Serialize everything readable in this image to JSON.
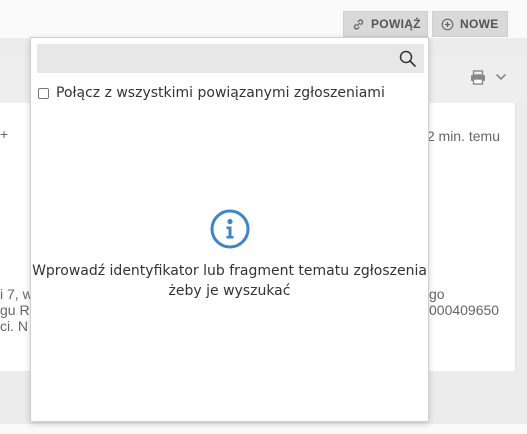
{
  "toolbar": {
    "link_button": "POWIĄŻ",
    "new_button": "NOWE",
    "link_icon": "link-icon",
    "new_icon": "plus-circle-icon"
  },
  "background": {
    "print_icon": "print-icon",
    "chevron_icon": "chevron-down-icon",
    "plus_fragment": "+",
    "time_fragment": "2 min. temu",
    "address_lines_left": [
      "i 7, w",
      "gu R",
      "ci. N"
    ],
    "address_lines_right": [
      "go",
      "000409650"
    ]
  },
  "popup": {
    "search": {
      "value": "",
      "placeholder": ""
    },
    "search_icon": "search-icon",
    "checkbox_label": "Połącz z wszystkimi powiązanymi zgłoszeniami",
    "checkbox_checked": false,
    "info_icon": "info-circle-icon",
    "info_line1": "Wprowadź identyfikator lub fragment tematu zgłoszenia",
    "info_line2": "żeby je wyszukać"
  },
  "colors": {
    "accent": "#3d85c6",
    "button_bg": "#d9d9d9"
  }
}
